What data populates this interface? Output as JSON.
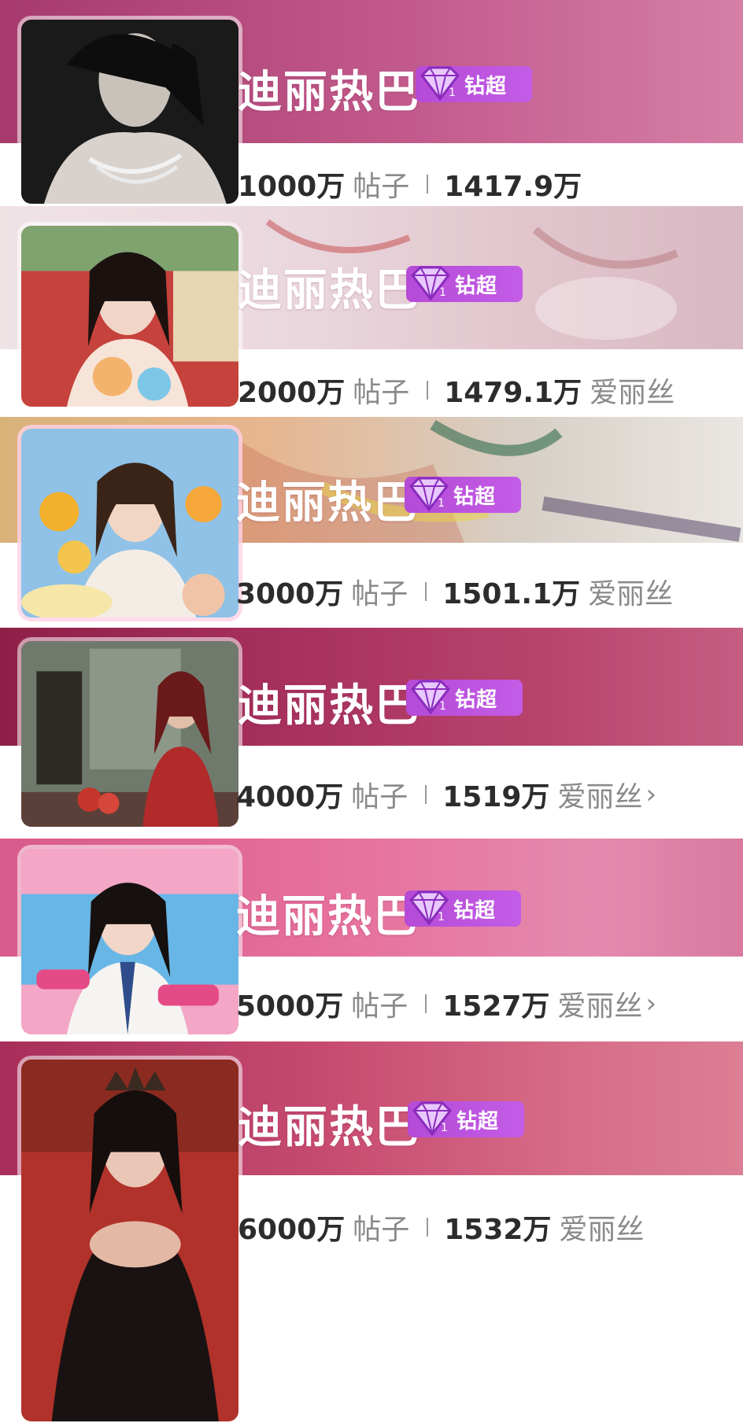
{
  "cards": [
    {
      "name": "迪丽热巴",
      "badge": "钻超",
      "posts": "1000万",
      "posts_unit": "帖子",
      "fans": "1417.9万",
      "fan_label": ""
    },
    {
      "name": "迪丽热巴",
      "badge": "钻超",
      "posts": "2000万",
      "posts_unit": "帖子",
      "fans": "1479.1万",
      "fan_label": "爱丽丝"
    },
    {
      "name": "迪丽热巴",
      "badge": "钻超",
      "posts": "3000万",
      "posts_unit": "帖子",
      "fans": "1501.1万",
      "fan_label": "爱丽丝"
    },
    {
      "name": "迪丽热巴",
      "badge": "钻超",
      "posts": "4000万",
      "posts_unit": "帖子",
      "fans": "1519万",
      "fan_label": "爱丽丝"
    },
    {
      "name": "迪丽热巴",
      "badge": "钻超",
      "posts": "5000万",
      "posts_unit": "帖子",
      "fans": "1527万",
      "fan_label": "爱丽丝"
    },
    {
      "name": "迪丽热巴",
      "badge": "钻超",
      "posts": "6000万",
      "posts_unit": "帖子",
      "fans": "1532万",
      "fan_label": "爱丽丝"
    }
  ],
  "chevron": "›",
  "colors": {
    "banner_1": "#b84f84",
    "banner_2": "#ead7de",
    "banner_3": "#e7b58e",
    "banner_4": "#a8315e",
    "banner_5": "#e6709c",
    "banner_6": "#c84c71",
    "badge": "#c35ce6"
  }
}
